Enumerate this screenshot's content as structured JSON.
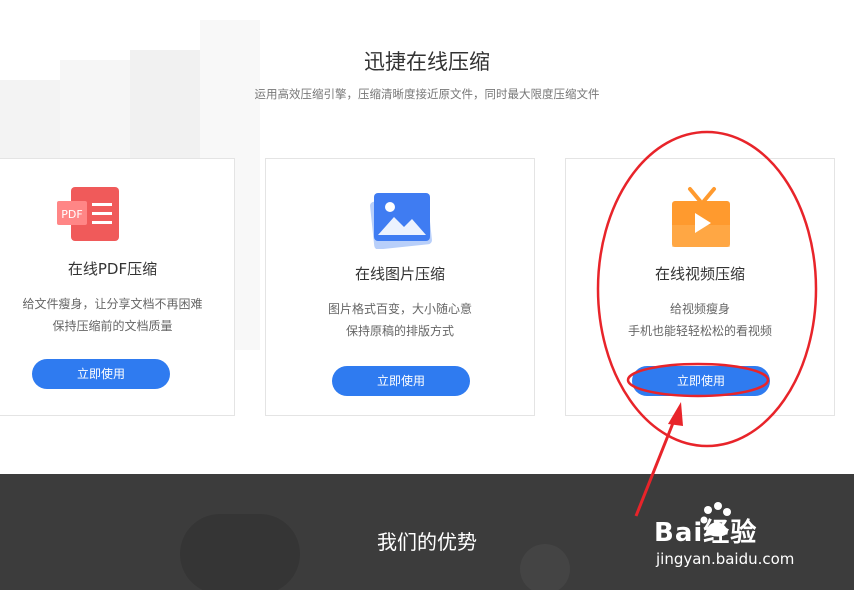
{
  "section": {
    "title": "迅捷在线压缩",
    "subtitle": "运用高效压缩引擎，压缩清晰度接近原文件，同时最大限度压缩文件"
  },
  "cards": [
    {
      "title": "在线PDF压缩",
      "icon": "pdf-file-icon",
      "icon_text": "PDF",
      "desc": [
        "给文件瘦身，让分享文档不再困难",
        "保持压缩前的文档质量"
      ],
      "button": "立即使用"
    },
    {
      "title": "在线图片压缩",
      "icon": "image-icon",
      "desc": [
        "图片格式百变，大小随心意",
        "保持原稿的排版方式"
      ],
      "button": "立即使用"
    },
    {
      "title": "在线视频压缩",
      "icon": "tv-play-icon",
      "desc": [
        "给视频瘦身",
        "手机也能轻轻松松的看视频"
      ],
      "button": "立即使用"
    }
  ],
  "advantages": {
    "title": "我们的优势"
  },
  "watermark": {
    "brand": "Bai经验",
    "domain": "jingyan.baidu.com"
  },
  "colors": {
    "accent": "#2f7bf0",
    "pdf": "#f05a5a",
    "image": "#3f7cf2",
    "video": "#ff9a2e",
    "annotation": "#e8242a",
    "footer": "#3c3c3c"
  }
}
